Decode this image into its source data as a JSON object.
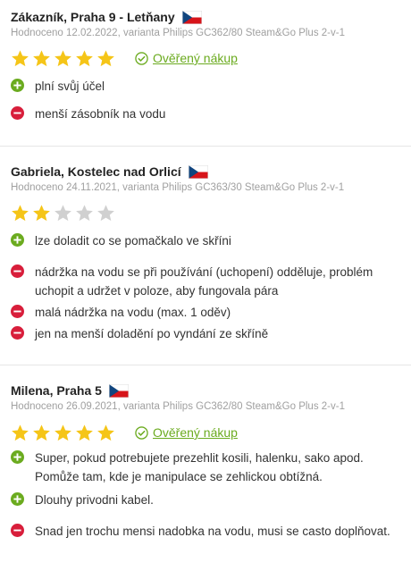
{
  "colors": {
    "plus": "#6bab1f",
    "minus": "#d81e3b",
    "star_on": "#f5c518",
    "star_off": "#d0d0d0",
    "verified": "#6bab1f"
  },
  "reviews": [
    {
      "author": "Zákazník, Praha 9 - Letňany",
      "flag_icon": "czech-flag-icon",
      "meta": "Hodnoceno 12.02.2022, varianta Philips GC362/80 Steam&Go Plus 2-v-1",
      "rating": 5,
      "rating_max": 5,
      "verified_label": "Ověřený nákup",
      "pros": [
        "plní svůj účel"
      ],
      "cons": [
        "menší zásobník na vodu"
      ]
    },
    {
      "author": "Gabriela, Kostelec nad Orlicí",
      "flag_icon": "czech-flag-icon",
      "meta": "Hodnoceno 24.11.2021, varianta Philips GC363/30 Steam&Go Plus 2-v-1",
      "rating": 2,
      "rating_max": 5,
      "pros": [
        "lze doladit co se pomačkalo ve skříni"
      ],
      "cons": [
        "nádržka na vodu se při používání (uchopení) odděluje, problém uchopit a udržet v poloze, aby fungovala pára",
        "malá nádržka na vodu (max. 1 oděv)",
        "jen na menší doladění po vyndání ze skříně"
      ]
    },
    {
      "author": "Milena, Praha 5",
      "flag_icon": "czech-flag-icon",
      "meta": "Hodnoceno 26.09.2021, varianta Philips GC362/80 Steam&Go Plus 2-v-1",
      "rating": 5,
      "rating_max": 5,
      "verified_label": "Ověřený nákup",
      "pros": [
        "Super, pokud potrebujete prezehlit kosili, halenku, sako apod. Pomůže tam, kde je manipulace se zehlickou obtížná.",
        "Dlouhy privodni kabel."
      ],
      "cons": [
        "Snad jen trochu mensi nadobka na vodu, musi se casto doplňovat."
      ]
    }
  ]
}
